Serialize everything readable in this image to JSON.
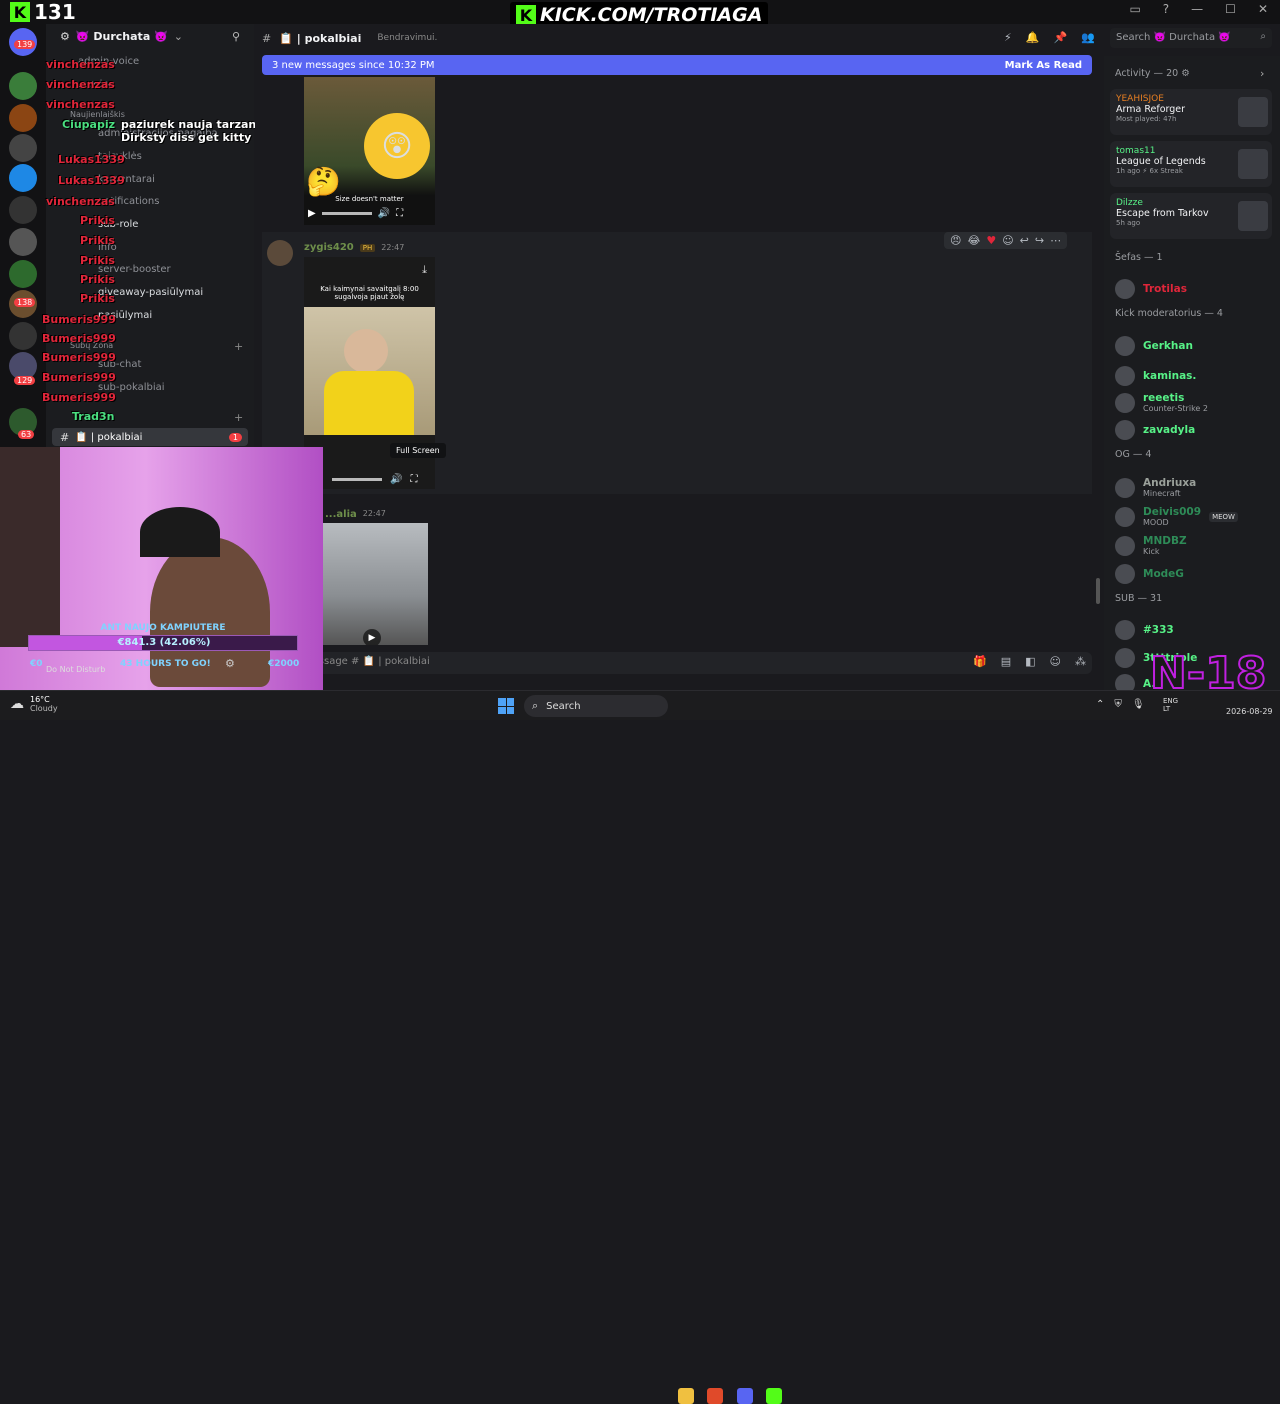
{
  "overlay": {
    "viewer_count": "131",
    "kick_banner": "KICK.COM/TROTIAGA",
    "age_badge": "N-18"
  },
  "window": {
    "search_placeholder": "Search 👿 Durchata 👿"
  },
  "server": {
    "name": "👿 Durchata 👿"
  },
  "channel": {
    "name": "📋 | pokalbiai",
    "topic": "Bendravimui.",
    "input_placeholder": "Message # 📋 | pokalbiai"
  },
  "sidebar": {
    "channels": [
      "admin-voice",
      "...voice",
      "Naujienlaiškis",
      "administracijos-pagalba",
      "taisyklės",
      "komentarai",
      "notifications",
      "sub-role",
      "info",
      "server-booster",
      "giveaway-pasiūlymai",
      "pasiūlymai",
      "Subų Zona",
      "sub-chat",
      "sub-pokalbiai",
      "Trad3n avis",
      "📋 | pokalbiai"
    ],
    "unread_badge": "1",
    "user_status": "Do Not Disturb",
    "server_badges": [
      "139",
      "138",
      "129",
      "63"
    ]
  },
  "stream_chat": [
    {
      "user": "vinchenzas",
      "color": "#e0263a",
      "msg": ""
    },
    {
      "user": "vinchenzas",
      "color": "#e0263a",
      "msg": ""
    },
    {
      "user": "vinchenzas",
      "color": "#e0263a",
      "msg": ""
    },
    {
      "user": "Ciupapiz",
      "color": "#4ade80",
      "msg": "paziurek nauja tarzano gabala - Dirksty diss get kitty . labai geras"
    },
    {
      "user": "Lukas1339",
      "color": "#e0263a",
      "msg": ""
    },
    {
      "user": "Lukas1339",
      "color": "#e0263a",
      "msg": ""
    },
    {
      "user": "vinchenzas",
      "color": "#e0263a",
      "msg": ""
    },
    {
      "user": "Prikis",
      "color": "#e0263a",
      "msg": ""
    },
    {
      "user": "Prikis",
      "color": "#e0263a",
      "msg": ""
    },
    {
      "user": "Prikis",
      "color": "#e0263a",
      "msg": ""
    },
    {
      "user": "Prikis",
      "color": "#e0263a",
      "msg": ""
    },
    {
      "user": "Prikis",
      "color": "#e0263a",
      "msg": ""
    },
    {
      "user": "Bumeris999",
      "color": "#e0263a",
      "msg": ""
    },
    {
      "user": "Bumeris999",
      "color": "#e0263a",
      "msg": ""
    },
    {
      "user": "Bumeris999",
      "color": "#e0263a",
      "msg": ""
    },
    {
      "user": "Bumeris999",
      "color": "#e0263a",
      "msg": ""
    },
    {
      "user": "Bumeris999",
      "color": "#e0263a",
      "msg": ""
    },
    {
      "user": "Trad3n",
      "color": "#4ade80",
      "msg": ""
    }
  ],
  "banner": {
    "text": "3 new messages since 10:32 PM",
    "action": "Mark As Read"
  },
  "messages": [
    {
      "video_caption": "Size doesn't matter"
    },
    {
      "author": "zygis420",
      "badge": "PH",
      "time": "22:47",
      "video_caption": "Kai kaimynai savaitgalį 8:00 sugalvoja pjaut žolę",
      "tooltip": "Full Screen"
    },
    {
      "author": "...alia",
      "time": "22:47"
    }
  ],
  "activity": {
    "header": "Activity — 20",
    "cards": [
      {
        "user": "YEAHISJOE",
        "game": "Arma Reforger",
        "detail": "Most played: 47h"
      },
      {
        "user": "tomas11",
        "game": "League of Legends",
        "detail": "1h ago  ⚡ 6x Streak"
      },
      {
        "user": "Dilzze",
        "game": "Escape from Tarkov",
        "detail": "5h ago"
      }
    ]
  },
  "member_groups": [
    {
      "header": "Šefas — 1",
      "members": [
        {
          "name": "Trotilas",
          "color": "#e0263a",
          "sub": ""
        }
      ]
    },
    {
      "header": "Kick moderatorius — 4",
      "members": [
        {
          "name": "Gerkhan",
          "color": "#57f287",
          "sub": ""
        },
        {
          "name": "kaminas.",
          "color": "#57f287",
          "sub": ""
        },
        {
          "name": "reeetis",
          "color": "#57f287",
          "sub": "Counter-Strike 2"
        },
        {
          "name": "zavadyla",
          "color": "#57f287",
          "sub": ""
        }
      ]
    },
    {
      "header": "OG — 4",
      "members": [
        {
          "name": "Andriuxa",
          "color": "#9aa09a",
          "sub": "Minecraft"
        },
        {
          "name": "Deivis009",
          "color": "#2e8b57",
          "sub": "MOOD",
          "tag": "MEOW"
        },
        {
          "name": "MNDBZ",
          "color": "#2e8b57",
          "sub": "Kick"
        },
        {
          "name": "ModeG",
          "color": "#2e8b57",
          "sub": ""
        }
      ]
    },
    {
      "header": "SUB — 31",
      "members": [
        {
          "name": "#333",
          "color": "#57f287",
          "sub": ""
        },
        {
          "name": "3ttttriple",
          "color": "#57f287",
          "sub": ""
        },
        {
          "name": "A...",
          "color": "#57f287",
          "sub": ""
        }
      ]
    }
  ],
  "webcam": {
    "goal_text": "ANT NAUJO KAMPIUTERE",
    "goal_amount": "€841.3 (42.06%)",
    "goal_progress": 0.42,
    "timer": "43 HOURS TO GO!",
    "goal_left": "€0",
    "goal_right": "€2000"
  },
  "taskbar": {
    "weather_temp": "16°C",
    "weather_desc": "Cloudy",
    "search": "Search",
    "lang": "ENG LT",
    "date": "2026-08-29"
  }
}
